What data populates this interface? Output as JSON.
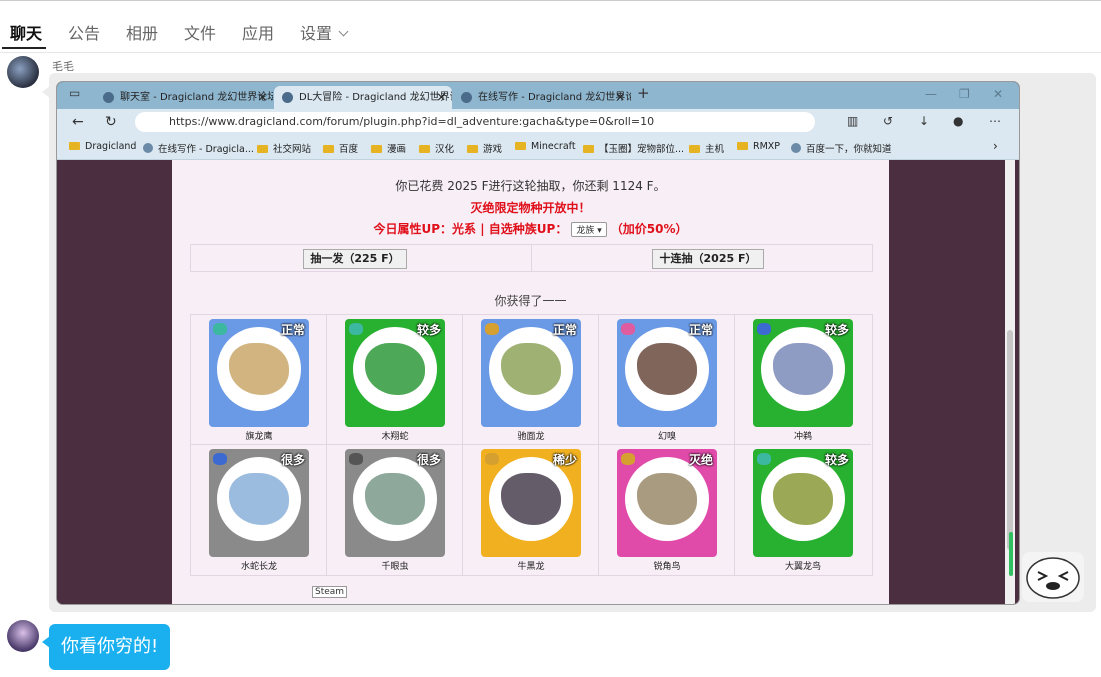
{
  "nav": {
    "tabs": [
      {
        "label": "聊天"
      },
      {
        "label": "公告"
      },
      {
        "label": "相册"
      },
      {
        "label": "文件"
      },
      {
        "label": "应用"
      },
      {
        "label": "设置"
      }
    ]
  },
  "message1": {
    "sender": "毛毛"
  },
  "browser": {
    "tabs": [
      {
        "label": "聊天室 - Dragicland 龙幻世界论坛"
      },
      {
        "label": "DL大冒险 - Dragicland 龙幻世界论坛"
      },
      {
        "label": "在线写作 - Dragicland 龙幻世界论坛"
      }
    ],
    "url": "https://www.dragicland.com/forum/plugin.php?id=dl_adventure:gacha&type=0&roll=10",
    "bookmarks": [
      {
        "label": "Dragicland"
      },
      {
        "label": "在线写作 - Dragicla..."
      },
      {
        "label": "社交网站"
      },
      {
        "label": "百度"
      },
      {
        "label": "漫画"
      },
      {
        "label": "汉化"
      },
      {
        "label": "游戏"
      },
      {
        "label": "Minecraft"
      },
      {
        "label": "【玉圈】宠物部位..."
      },
      {
        "label": "主机"
      },
      {
        "label": "RMXP"
      },
      {
        "label": "百度一下，你就知道"
      }
    ],
    "page": {
      "cost_text": "你已花费 2025 F进行这轮抽取，你还剩 1124 F。",
      "limited_text": "灭绝限定物种开放中！",
      "up_prefix": "今日属性UP：光系 | 自选种族UP：",
      "up_select": "龙族",
      "up_suffix": "（加价50%）",
      "single_button": "抽一发（225 F）",
      "ten_button": "十连抽（2025 F）",
      "result_title": "你获得了一一",
      "steam_tooltip": "Steam",
      "cards": [
        {
          "name": "旗龙鹰",
          "rarity": "正常",
          "bg": "#6a9ae6",
          "elem": "#3cb8a0",
          "creature": "#c9a76a"
        },
        {
          "name": "木翔蛇",
          "rarity": "较多",
          "bg": "#28b030",
          "elem": "#3cb8a0",
          "creature": "#2e9a3a"
        },
        {
          "name": "驰面龙",
          "rarity": "正常",
          "bg": "#6a9ae6",
          "elem": "#d6a030",
          "creature": "#8fa45a"
        },
        {
          "name": "幻嗅",
          "rarity": "正常",
          "bg": "#6a9ae6",
          "elem": "#e05ca0",
          "creature": "#6a4a3e"
        },
        {
          "name": "冲鹈",
          "rarity": "较多",
          "bg": "#28b030",
          "elem": "#3c6ad0",
          "creature": "#7a8ab8"
        },
        {
          "name": "水蛇长龙",
          "rarity": "很多",
          "bg": "#8a8a8a",
          "elem": "#3c6ad0",
          "creature": "#8ab0d8"
        },
        {
          "name": "千眼虫",
          "rarity": "很多",
          "bg": "#8a8a8a",
          "elem": "#555555",
          "creature": "#7a9a8a"
        },
        {
          "name": "牛黑龙",
          "rarity": "稀少",
          "bg": "#f0b020",
          "elem": "#d6a030",
          "creature": "#4a4050"
        },
        {
          "name": "锐角鸟",
          "rarity": "灭绝",
          "bg": "#e04aa8",
          "elem": "#d6a030",
          "creature": "#9a8a6a"
        },
        {
          "name": "大翼龙鸟",
          "rarity": "较多",
          "bg": "#28b030",
          "elem": "#3cb8a0",
          "creature": "#8a9a3a"
        }
      ]
    }
  },
  "message2": {
    "text": "你看你穷的!"
  },
  "colors": {
    "accent": "#1ab0ef",
    "red": "#e0101a"
  }
}
